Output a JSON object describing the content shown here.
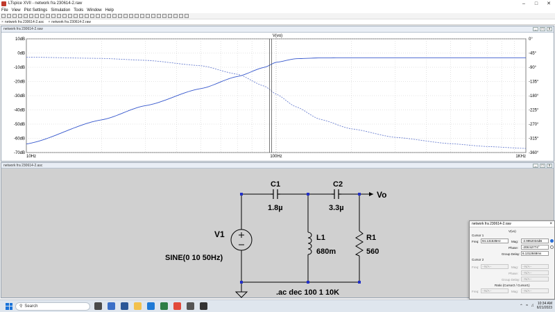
{
  "window": {
    "title": "LTspice XVII - network fra 230614-2.raw"
  },
  "menu": [
    "File",
    "View",
    "Plot Settings",
    "Simulation",
    "Tools",
    "Window",
    "Help"
  ],
  "doc_tabs": [
    "network fra 230614-2.asc",
    "network fra 230614-2.raw"
  ],
  "plot_window": {
    "title": "network fra 230614-2.raw",
    "trace_label": "V(vo)"
  },
  "chart_data": {
    "type": "line",
    "title": "",
    "xlabel": "",
    "ylabel": "",
    "x_scale": "log",
    "xlim": [
      10,
      1000
    ],
    "x_ticks": [
      "10Hz",
      "100Hz",
      "1KHz"
    ],
    "ylim_left": [
      -70,
      10
    ],
    "y_ticks_left": [
      "10dB",
      "0dB",
      "-10dB",
      "-20dB",
      "-30dB",
      "-40dB",
      "-50dB",
      "-60dB",
      "-70dB"
    ],
    "ylim_right": [
      -360,
      0
    ],
    "y_ticks_right": [
      "0°",
      "-45°",
      "-90°",
      "-135°",
      "-180°",
      "-225°",
      "-270°",
      "-315°",
      "-360°"
    ],
    "grid": true,
    "series": [
      {
        "name": "",
        "axis": "left",
        "style": "solid",
        "color": "#3355cc",
        "x": [
          10,
          20,
          30,
          50,
          70,
          90,
          100,
          120,
          150,
          200,
          300,
          500,
          700,
          1000
        ],
        "y": [
          -64,
          -47,
          -37,
          -25,
          -16.5,
          -10,
          -6.5,
          -4,
          -3.4,
          -3.3,
          -3.3,
          -3.3,
          -3.3,
          -3.3
        ]
      },
      {
        "name": "",
        "axis": "right",
        "style": "dashed",
        "color": "#3355cc",
        "x": [
          10,
          20,
          30,
          50,
          70,
          90,
          100,
          120,
          150,
          200,
          300,
          500,
          700,
          1000
        ],
        "y": [
          -58,
          -62,
          -68,
          -85,
          -112,
          -150,
          -175,
          -215,
          -255,
          -285,
          -312,
          -332,
          -341,
          -347
        ]
      }
    ]
  },
  "schematic": {
    "title": "network fra 230614-2.asc",
    "components": {
      "c1": {
        "name": "C1",
        "value": "1.8µ"
      },
      "c2": {
        "name": "C2",
        "value": "3.3µ"
      },
      "l1": {
        "name": "L1",
        "value": "680m"
      },
      "r1": {
        "name": "R1",
        "value": "560"
      },
      "v1": {
        "name": "V1",
        "value": "SINE(0 10 50Hz)"
      }
    },
    "net_label": "Vo",
    "directive": ".ac dec 100 1 10K"
  },
  "cursor_dialog": {
    "title": "network fra 230614-2.raw",
    "trace": "V(vo)",
    "cursor1_label": "Cursor 1",
    "freq_label": "Freq:",
    "freq_value": "94.131535Hz",
    "mag_label": "Mag:",
    "mag_value": "-2.9952034dB",
    "phase_label": "Phase:",
    "phase_value": "-208.52774°",
    "gd_label": "Group Delay:",
    "gd_value": "6.1312848ms",
    "cursor2_label": "Cursor 2",
    "na": "--N/A--",
    "ratio_label": "Ratio (Cursor2 / Cursor1)"
  },
  "taskbar": {
    "search_placeholder": "Search",
    "time": "10:34 AM",
    "date": "6/21/2023"
  }
}
